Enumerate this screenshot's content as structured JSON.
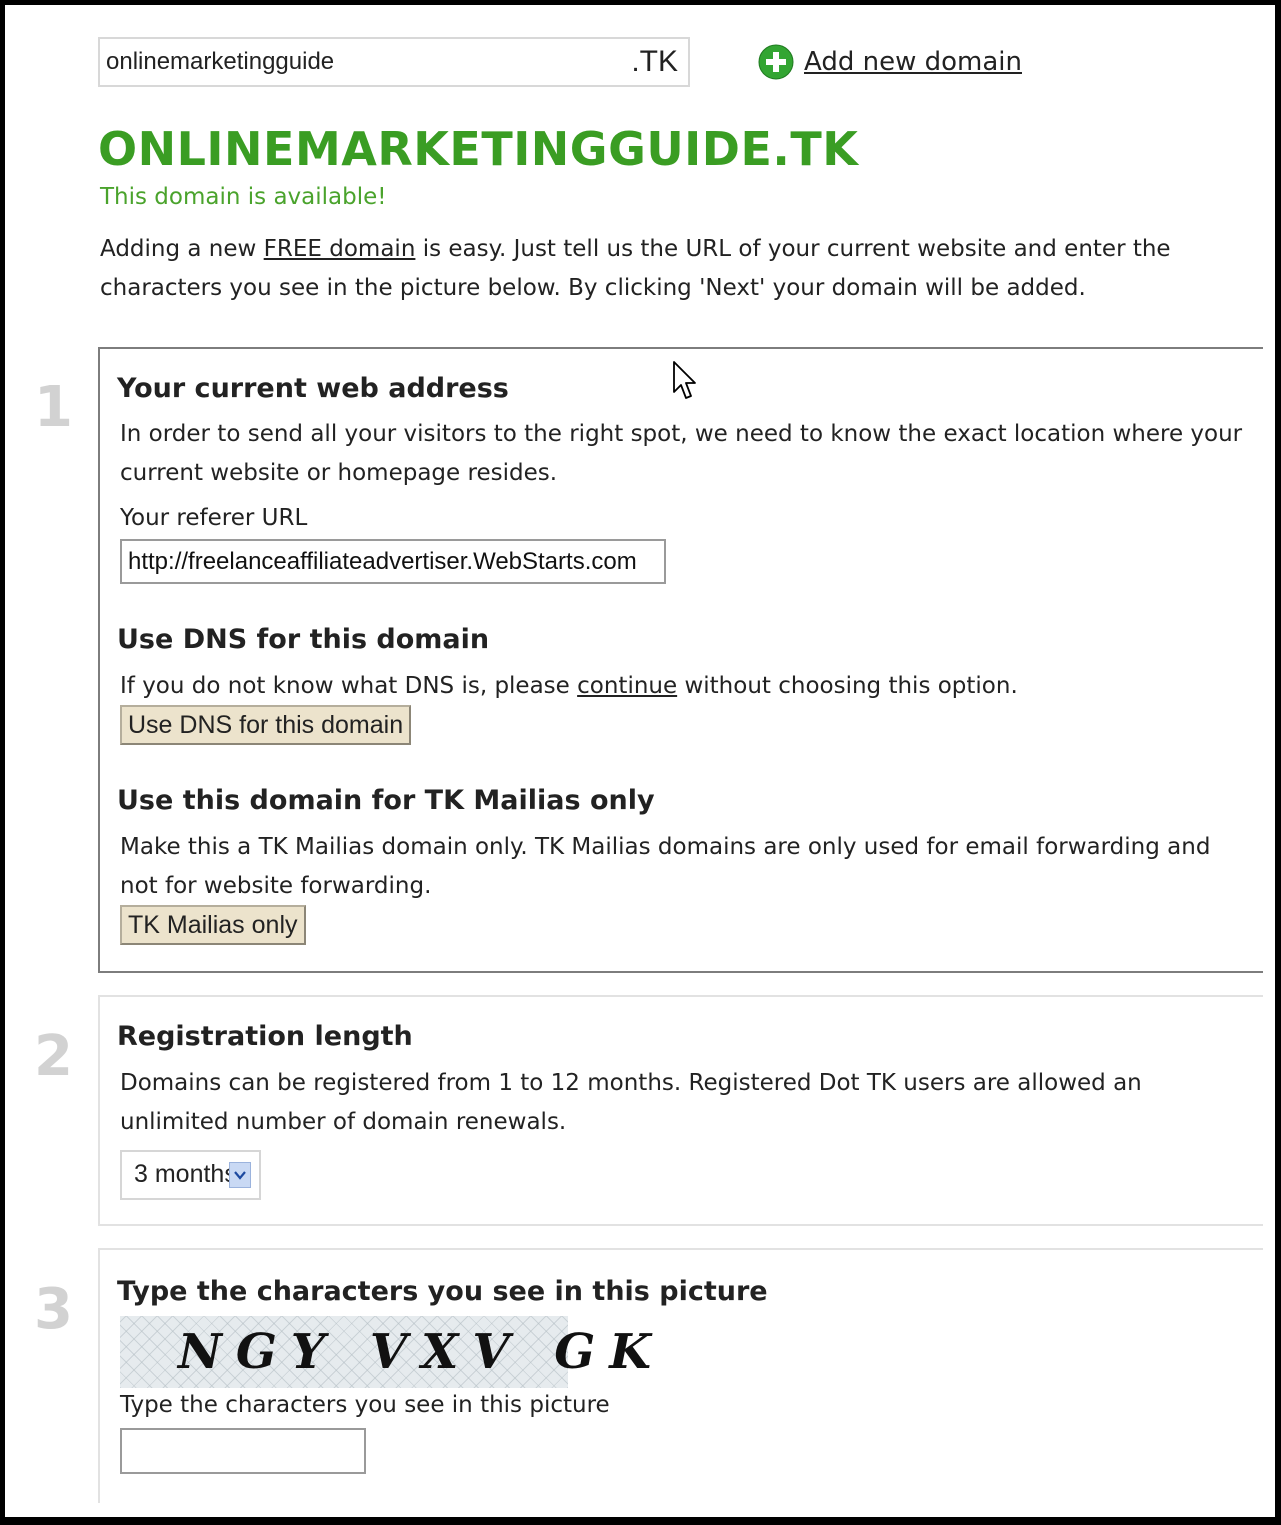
{
  "search": {
    "domain_value": "onlinemarketingguide",
    "tld": ".TK",
    "add_domain_label": "Add new domain"
  },
  "header": {
    "title": "ONLINEMARKETINGGUIDE.TK",
    "status": "This domain is available!",
    "intro_before": "Adding a new ",
    "intro_link": "FREE domain",
    "intro_after": " is easy. Just tell us the URL of your current website and enter the characters you see in the picture below. By clicking 'Next' your domain will be added."
  },
  "step1": {
    "number": "1",
    "title": "Your current web address",
    "description": "In order to send all your visitors to the right spot, we need to know the exact location where your current website or homepage resides.",
    "url_label": "Your referer URL",
    "url_value": "http://freelanceaffiliateadvertiser.WebStarts.com",
    "dns_title": "Use DNS for this domain",
    "dns_before": "If you do not know what DNS is, please ",
    "dns_link": "continue",
    "dns_after": " without choosing this option.",
    "dns_button": "Use DNS for this domain",
    "mailias_title": "Use this domain for TK Mailias only",
    "mailias_description": "Make this a TK Mailias domain only. TK Mailias domains are only used for email forwarding and not for website forwarding.",
    "mailias_button": "TK Mailias only"
  },
  "step2": {
    "number": "2",
    "title": "Registration length",
    "description": "Domains can be registered from 1 to 12 months. Registered Dot TK users are allowed an unlimited number of domain renewals.",
    "selected": "3 months"
  },
  "step3": {
    "number": "3",
    "title": "Type the characters you see in this picture",
    "captcha": "NGY VXV GK",
    "input_label": "Type the characters you see in this picture"
  },
  "colors": {
    "title_green": "#3a9d23",
    "status_green": "#4aa32c",
    "button_bg": "#ece3cc",
    "step_number_gray": "#d2d2d2"
  },
  "icons": {
    "add": "plus-circle-icon",
    "dropdown": "chevron-down-icon",
    "pointer": "mouse-cursor-icon"
  }
}
